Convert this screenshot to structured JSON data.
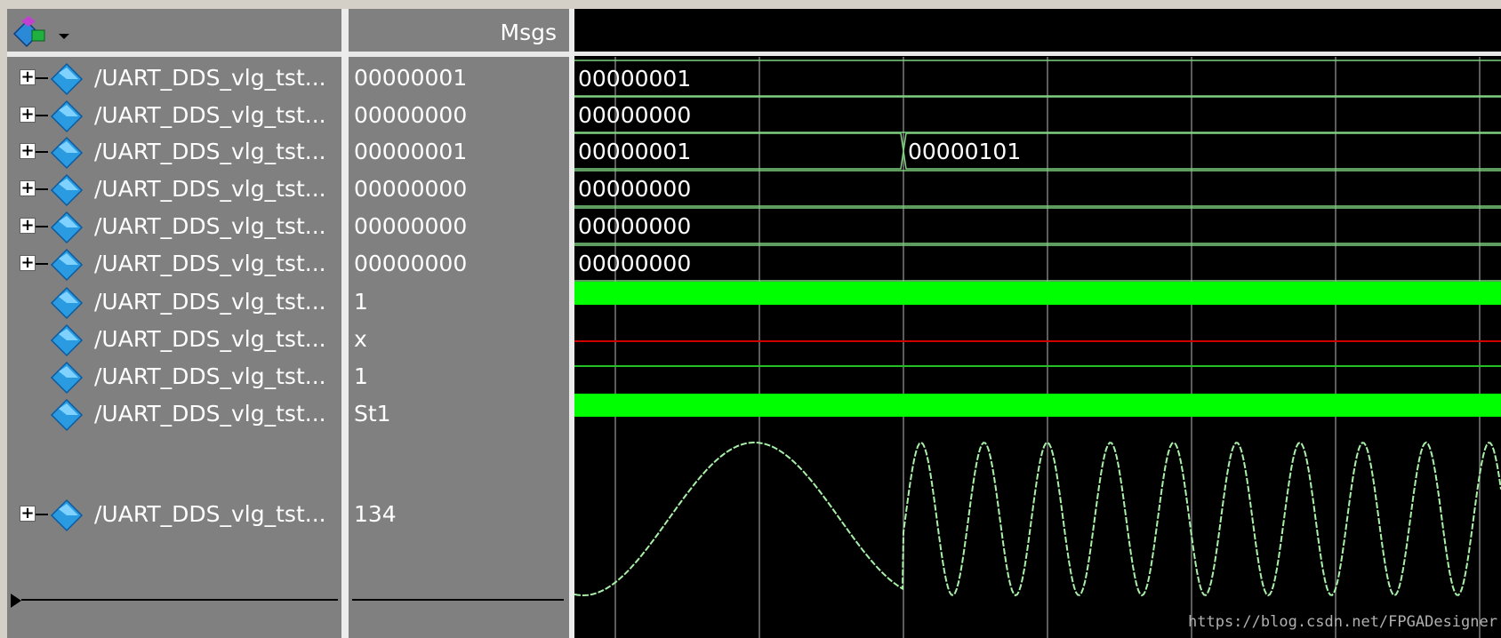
{
  "msgs_header": {
    "title": "Msgs"
  },
  "signals": [
    {
      "name": "/UART_DDS_vlg_tst...",
      "value": "00000001",
      "expandable": true
    },
    {
      "name": "/UART_DDS_vlg_tst...",
      "value": "00000000",
      "expandable": true
    },
    {
      "name": "/UART_DDS_vlg_tst...",
      "value": "00000001",
      "expandable": true
    },
    {
      "name": "/UART_DDS_vlg_tst...",
      "value": "00000000",
      "expandable": true
    },
    {
      "name": "/UART_DDS_vlg_tst...",
      "value": "00000000",
      "expandable": true
    },
    {
      "name": "/UART_DDS_vlg_tst...",
      "value": "00000000",
      "expandable": true
    },
    {
      "name": "/UART_DDS_vlg_tst...",
      "value": "1",
      "expandable": false
    },
    {
      "name": "/UART_DDS_vlg_tst...",
      "value": "x",
      "expandable": false
    },
    {
      "name": "/UART_DDS_vlg_tst...",
      "value": "1",
      "expandable": false
    },
    {
      "name": "/UART_DDS_vlg_tst...",
      "value": "St1",
      "expandable": false
    },
    {
      "name": "/UART_DDS_vlg_tst...",
      "value": "134",
      "expandable": true
    }
  ],
  "waves": {
    "bus_labels": [
      [
        "00000001"
      ],
      [
        "00000000"
      ],
      [
        "00000001",
        "00000101"
      ],
      [
        "00000000"
      ],
      [
        "00000000"
      ],
      [
        "00000000"
      ]
    ]
  },
  "colors": {
    "bus": "#7fd07f",
    "strong": "#00ff00",
    "unknown": "#d00000",
    "analog": "#a8f0a8",
    "grid": "#7a7a7a"
  },
  "watermark": "https://blog.csdn.net/FPGADesigner"
}
